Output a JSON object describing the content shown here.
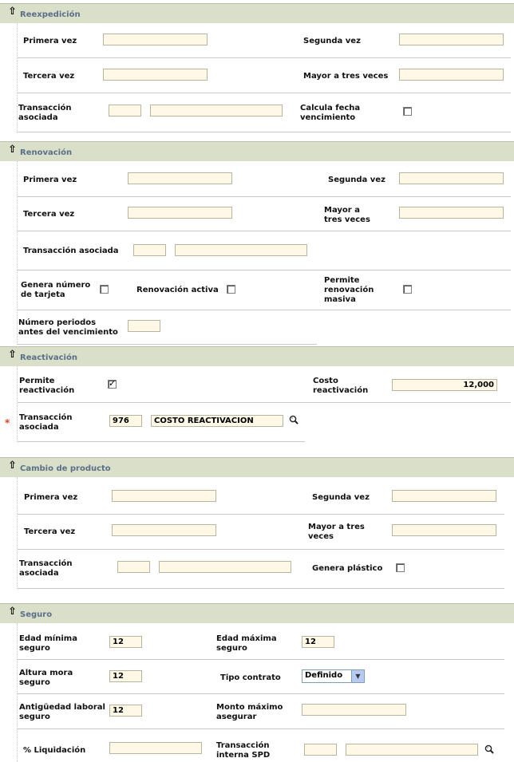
{
  "reexpedicion": {
    "title": "Reexpedición",
    "primera_vez": "Primera vez",
    "segunda_vez": "Segunda vez",
    "tercera_vez": "Tercera vez",
    "mayor_tres": "Mayor a tres veces",
    "transaccion": "Transacción asociada",
    "calcula_fecha": "Calcula fecha vencimiento"
  },
  "renovacion": {
    "title": "Renovación",
    "primera_vez": "Primera vez",
    "segunda_vez": "Segunda vez",
    "tercera_vez": "Tercera vez",
    "mayor_tres": "Mayor a tres veces",
    "transaccion": "Transacción asociada",
    "genera_numero": "Genera número de tarjeta",
    "renovacion_activa": "Renovación activa",
    "permite_masiva": "Permite renovación masiva",
    "numero_periodos": "Número periodos antes del vencimiento"
  },
  "reactivacion": {
    "title": "Reactivación",
    "permite": "Permite reactivación",
    "permite_checked": true,
    "costo_label": "Costo reactivación",
    "costo_value": "12,000",
    "required_mark": "*",
    "transaccion_label": "Transacción asociada",
    "transaccion_code": "976",
    "transaccion_desc": "COSTO REACTIVACION"
  },
  "cambio": {
    "title": "Cambio de producto",
    "primera_vez": "Primera vez",
    "segunda_vez": "Segunda vez",
    "tercera_vez": "Tercera vez",
    "mayor_tres": "Mayor a tres veces",
    "transaccion": "Transacción asociada",
    "genera_plastico": "Genera plástico"
  },
  "seguro": {
    "title": "Seguro",
    "edad_minima": "Edad mínima seguro",
    "edad_minima_val": "12",
    "edad_maxima": "Edad máxima seguro",
    "edad_maxima_val": "12",
    "altura_mora": "Altura mora seguro",
    "altura_mora_val": "12",
    "tipo_contrato": "Tipo contrato",
    "tipo_contrato_val": "Definido",
    "antiguedad": "Antigüedad laboral seguro",
    "antiguedad_val": "12",
    "monto_maximo": "Monto máximo asegurar",
    "liquidacion": "% Liquidación",
    "transaccion_spd": "Transacción interna SPD"
  },
  "icons": {
    "collapse": "arrow-up-icon",
    "lookup": "magnifier-icon"
  }
}
